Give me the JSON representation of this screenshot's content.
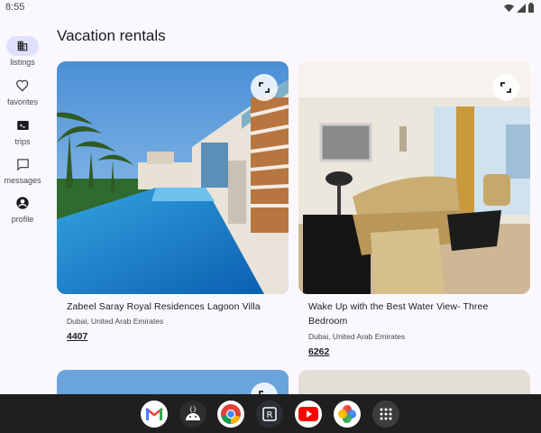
{
  "status_bar": {
    "time": "8:55"
  },
  "nav_rail": {
    "items": [
      {
        "label": "listings",
        "icon": "building-icon",
        "active": true
      },
      {
        "label": "favorites",
        "icon": "heart-icon",
        "active": false
      },
      {
        "label": "trips",
        "icon": "ticket-icon",
        "active": false
      },
      {
        "label": "messages",
        "icon": "chat-icon",
        "active": false
      },
      {
        "label": "profile",
        "icon": "account-circle-icon",
        "active": false
      }
    ]
  },
  "page": {
    "title": "Vacation rentals"
  },
  "listings": [
    {
      "title": "Zabeel Saray Royal Residences Lagoon Villa",
      "location": "Dubai, United Arab Emirates",
      "price": "4407"
    },
    {
      "title": "Wake Up with the Best Water View- Three Bedroom",
      "location": "Dubai, United Arab Emirates",
      "price": "6262"
    }
  ],
  "taskbar": {
    "apps": [
      "gmail-icon",
      "android-dev-icon",
      "chrome-icon",
      "reply-app-icon",
      "youtube-icon",
      "photos-icon",
      "app-drawer-icon"
    ]
  },
  "colors": {
    "accent": "#dfe0ff",
    "background": "#fbf8fd",
    "taskbar": "#1f1f1f"
  }
}
